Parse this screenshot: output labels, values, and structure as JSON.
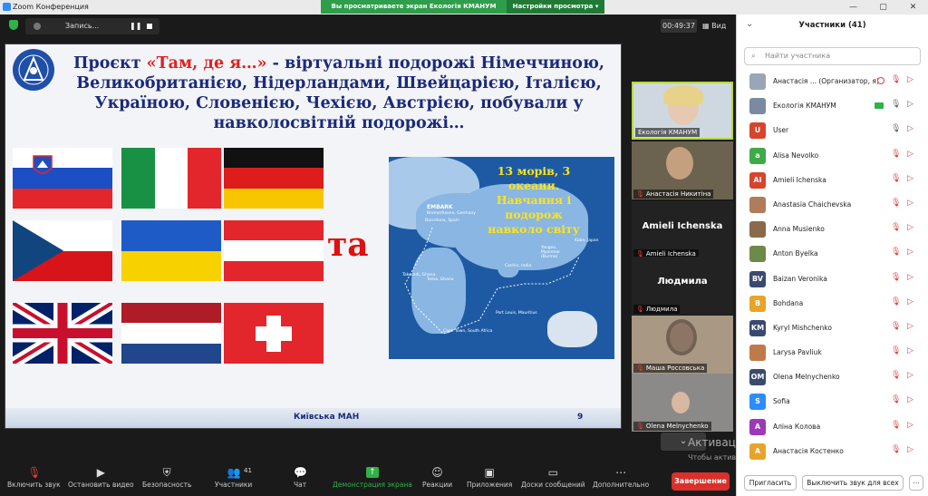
{
  "app": {
    "title": "Zoom Конференция"
  },
  "banner": {
    "sharing_text": "Вы просматриваете экран Екологія КМАНУМ",
    "view_settings": "Настройки просмотра ▾"
  },
  "window_controls": {
    "minimize": "—",
    "maximize": "▢",
    "close": "✕"
  },
  "recording": {
    "label": "Запись...",
    "pause": "❚❚"
  },
  "meeting": {
    "timer": "00:49:37",
    "view": "▦ Вид"
  },
  "slide": {
    "title_prefix": "Проєкт ",
    "title_highlight": "«Там, де я…»",
    "title_rest": " - віртуальні подорожі Німеччиною, Великобританією, Нідерландами, Швейцарією, Італією, Україною, Словенією, Чехією, Австрією, побували у навколосвітній подорожі…",
    "ta_label": "та",
    "map_text": "13 морів, 3 океани. Навчання і подорож навколо світу",
    "map_labels": {
      "embark": "EMBARK",
      "bremerhaven": "Bremerhaven, Germany",
      "barcelona": "Barcelona, Spain",
      "takoradi": "Takoradi, Ghana",
      "tema": "Tema, Ghana",
      "capetown": "Cape Town, South Africa",
      "cochin": "Cochin, India",
      "yangon": "Yangon, Myanmar (Burma)",
      "kobe": "Kobe, Japan",
      "port_louis": "Port Louis, Mauritius"
    },
    "footer": "Київська МАН",
    "page_number": "9"
  },
  "videos": [
    {
      "name": "Екологія КМАНУМ",
      "muted": false
    },
    {
      "name": "Анастасія Никитіна",
      "muted": true
    },
    {
      "name": "Amieli Ichenska",
      "big": "Amieli Ichenska",
      "muted": true
    },
    {
      "name": "Людмила",
      "big": "Людмила",
      "muted": true
    },
    {
      "name": "Маша Россовська",
      "muted": true
    },
    {
      "name": "Olena Melnychenko",
      "muted": true
    }
  ],
  "toolbar": {
    "unmute": "Включить звук",
    "video": "Остановить видео",
    "security": "Безопасность",
    "participants": "Участники",
    "participants_count": "41",
    "chat": "Чат",
    "share": "Демонстрация экрана",
    "reactions": "Реакции",
    "apps": "Приложения",
    "whiteboard": "Доски сообщений",
    "more": "Дополнительно",
    "end": "Завершение"
  },
  "windows_activation": {
    "title": "Активация Windows",
    "subtitle": "Чтобы активировать Windows, перейдите в раздел \"Параметры\"."
  },
  "participants_panel": {
    "title": "Участники (41)",
    "search_placeholder": "Найти участника",
    "invite": "Пригласить",
    "mute_all": "Выключить звук для всех",
    "items": [
      {
        "initials": "",
        "name": "Анастасія ... (Организатор, я)",
        "color": "#9aa5b8",
        "state": "host"
      },
      {
        "initials": "",
        "name": "Екологія КМАНУМ",
        "color": "#7a8aa0",
        "state": "sharing"
      },
      {
        "initials": "U",
        "name": "User",
        "color": "#d6452c",
        "state": "cam_off"
      },
      {
        "initials": "a",
        "name": "Alisa Nevolko",
        "color": "#3faa48",
        "state": "muted"
      },
      {
        "initials": "AI",
        "name": "Amieli Ichenska",
        "color": "#d6452c",
        "state": "muted"
      },
      {
        "initials": "",
        "name": "Anastasia Chaichevska",
        "color": "#b07c5a",
        "state": "muted"
      },
      {
        "initials": "",
        "name": "Anna Musienko",
        "color": "#8a6a4a",
        "state": "muted"
      },
      {
        "initials": "",
        "name": "Anton Byelka",
        "color": "#6e8a4a",
        "state": "muted"
      },
      {
        "initials": "BV",
        "name": "Baizan Veronika",
        "color": "#3a4a6e",
        "state": "muted"
      },
      {
        "initials": "B",
        "name": "Bohdana",
        "color": "#e8a42a",
        "state": "muted"
      },
      {
        "initials": "KM",
        "name": "Kyryl Mishchenko",
        "color": "#3a4a6e",
        "state": "muted"
      },
      {
        "initials": "",
        "name": "Larysa Pavliuk",
        "color": "#c07a4a",
        "state": "muted"
      },
      {
        "initials": "OM",
        "name": "Olena Melnychenko",
        "color": "#3a4a6e",
        "state": "muted"
      },
      {
        "initials": "S",
        "name": "Sofia",
        "color": "#2d8cff",
        "state": "muted"
      },
      {
        "initials": "A",
        "name": "Аліна Колова",
        "color": "#9a3ab8",
        "state": "muted"
      },
      {
        "initials": "A",
        "name": "Анастасія Костенко",
        "color": "#e8a42a",
        "state": "muted"
      }
    ]
  },
  "colors": {
    "share_green": "#2fb24a",
    "end_red": "#d9302b",
    "mute_red": "#e04040",
    "slide_title": "#1b2a7a"
  },
  "icons": {
    "mic_muted": "mic-muted-icon",
    "cam_off": "camera-off-icon"
  }
}
